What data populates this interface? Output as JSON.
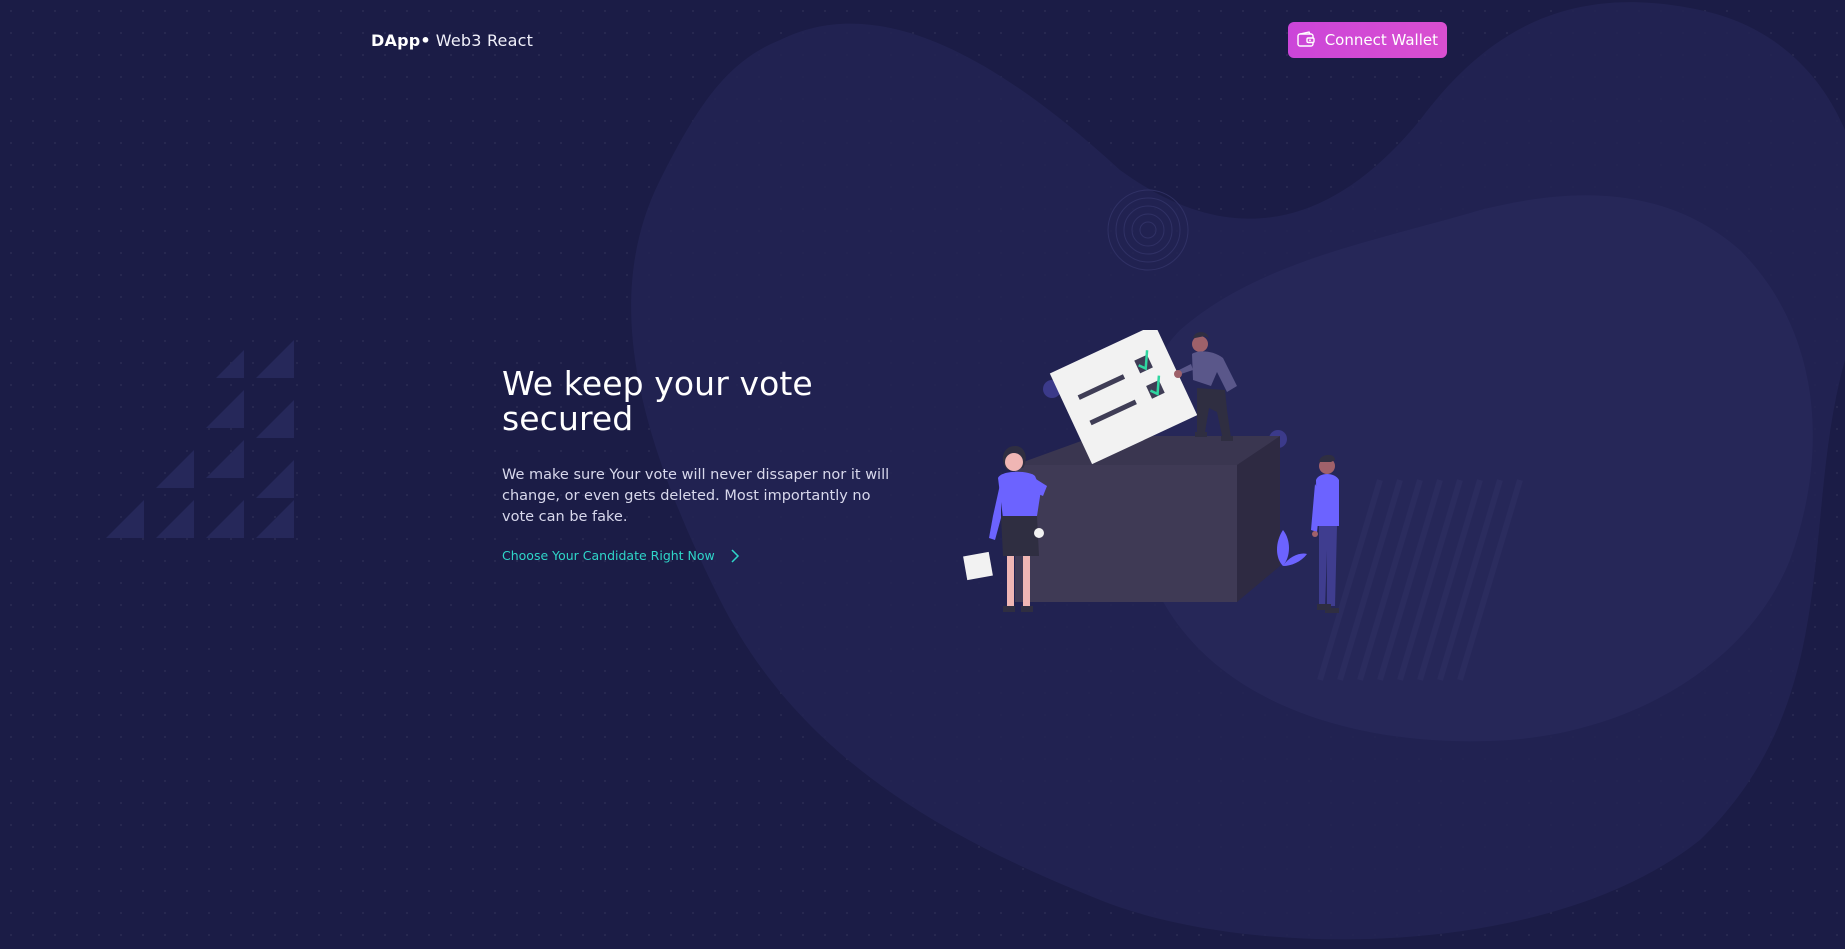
{
  "header": {
    "brand_strong": "DApp•",
    "brand_light": "Web3 React",
    "connect_label": "Connect Wallet",
    "connect_icon": "wallet-icon"
  },
  "hero": {
    "title": "We keep your vote secured",
    "description": "We make sure Your vote will never dissaper nor it will change, or even gets deleted. Most importantly no vote can be fake.",
    "cta_label": "Choose Your Candidate Right Now",
    "cta_icon": "chevron-right-icon"
  },
  "colors": {
    "background": "#1b1c46",
    "accent": "#d14cd6",
    "link": "#2fd6c9",
    "illustration_purple": "#6c63ff"
  }
}
